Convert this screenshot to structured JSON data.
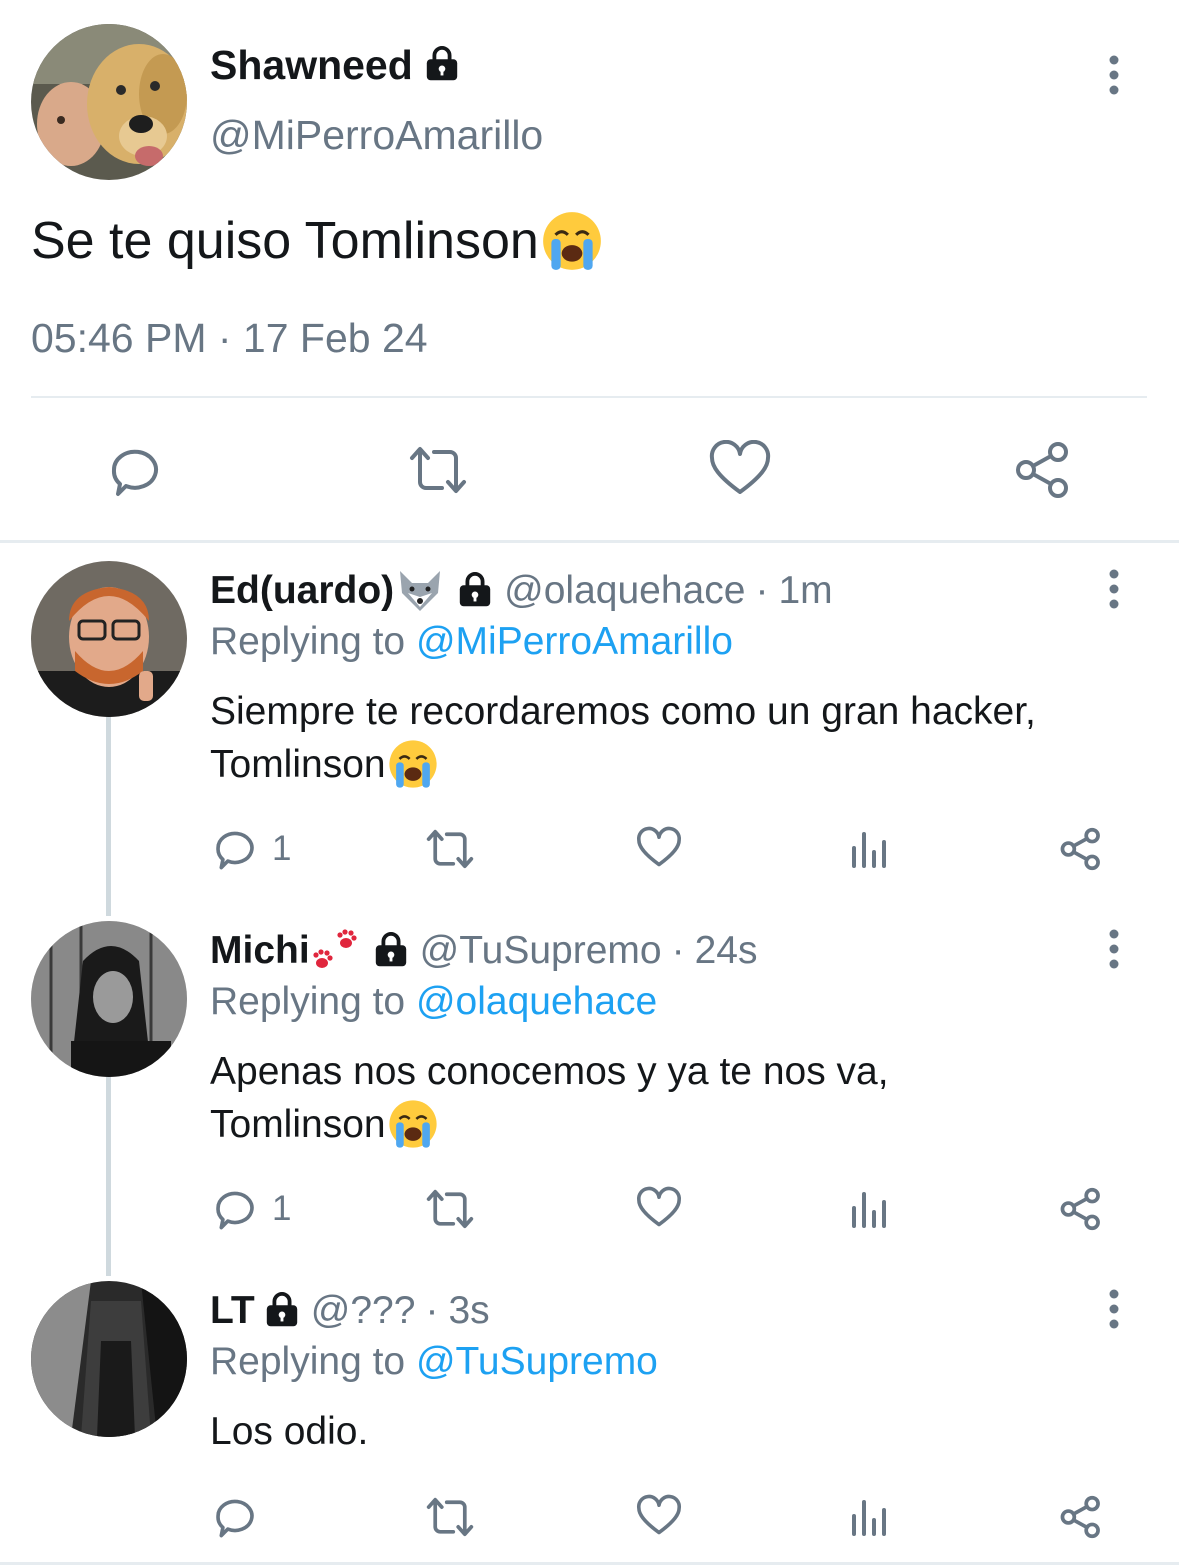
{
  "main_tweet": {
    "display_name": "Shawneed",
    "handle": "@MiPerroAmarillo",
    "text": "Se te quiso Tomlinson",
    "timestamp": "05:46 PM · 17 Feb 24",
    "icons": [
      "lock-icon",
      "more-vertical-icon",
      "reply-icon",
      "retweet-icon",
      "like-icon",
      "share-icon"
    ]
  },
  "replies": [
    {
      "display_name": "Ed(uardo)",
      "handle": "@olaquehace",
      "separator": "·",
      "time": "1m",
      "replying_label": "Replying to",
      "replying_to": "@MiPerroAmarillo",
      "text_line1": "Siempre te recordaremos como un gran hacker,",
      "text_line2": "Tomlinson",
      "reply_count": "1"
    },
    {
      "display_name": "Michi",
      "handle": "@TuSupremo",
      "separator": "·",
      "time": "24s",
      "replying_label": "Replying to",
      "replying_to": "@olaquehace",
      "text_line1": "Apenas nos conocemos y ya te nos va,",
      "text_line2": "Tomlinson",
      "reply_count": "1"
    },
    {
      "display_name": "LT",
      "handle": "@???",
      "separator": "·",
      "time": "3s",
      "replying_label": "Replying to",
      "replying_to": "@TuSupremo",
      "text_line1": "Los odio.",
      "text_line2": "",
      "reply_count": ""
    }
  ],
  "colors": {
    "link": "#1da1f2",
    "secondary_text": "#687684",
    "primary_text": "#14171a",
    "divider": "#e6ecf0"
  }
}
